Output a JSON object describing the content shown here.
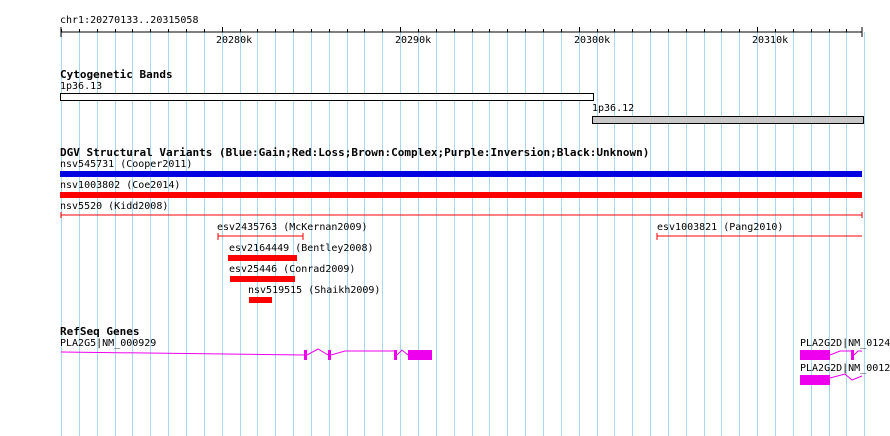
{
  "location": "chr1:20270133..20315058",
  "ruler": {
    "ticks": [
      "20280k",
      "20290k",
      "20300k",
      "20310k"
    ]
  },
  "tracks": {
    "cytoband": {
      "title": "Cytogenetic Bands",
      "bands": [
        {
          "label": "1p36.13",
          "fill": "#ffffff"
        },
        {
          "label": "1p36.12",
          "fill": "#c8c8c8"
        }
      ]
    },
    "dgv": {
      "title": "DGV Structural Variants (Blue:Gain;Red:Loss;Brown:Complex;Purple:Inversion;Black:Unknown)",
      "features": [
        {
          "label": "nsv545731 (Cooper2011)",
          "color": "#0000e0",
          "style": "bar"
        },
        {
          "label": "nsv1003802 (Coe2014)",
          "color": "#ff0000",
          "style": "bar"
        },
        {
          "label": "nsv5520 (Kidd2008)",
          "color": "#ff0000",
          "style": "line"
        },
        {
          "label": "esv2435763 (McKernan2009)",
          "color": "#ff0000",
          "style": "line"
        },
        {
          "label": "esv1003821 (Pang2010)",
          "color": "#ff0000",
          "style": "line"
        },
        {
          "label": "esv2164449 (Bentley2008)",
          "color": "#ff0000",
          "style": "bar"
        },
        {
          "label": "esv25446 (Conrad2009)",
          "color": "#ff0000",
          "style": "bar"
        },
        {
          "label": "nsv519515 (Shaikh2009)",
          "color": "#ff0000",
          "style": "bar"
        }
      ]
    },
    "refseq": {
      "title": "RefSeq Genes",
      "color": "#ee00ee",
      "genes": [
        {
          "label": "PLA2G5|NM_000929"
        },
        {
          "label": "PLA2G2D|NM_0124"
        },
        {
          "label": "PLA2G2D|NM_0012"
        }
      ]
    }
  },
  "colors": {
    "grid": "#a8d8ee",
    "ruler": "#000000"
  }
}
